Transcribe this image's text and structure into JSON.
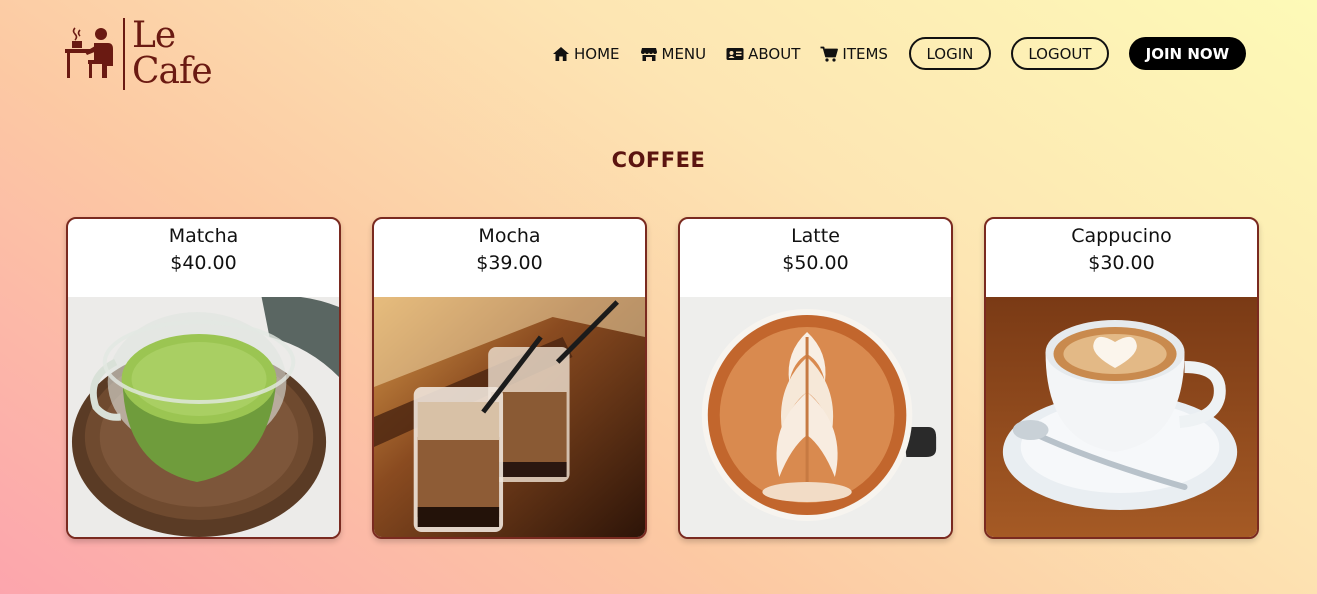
{
  "logo": {
    "line1": "Le",
    "line2": "Cafe"
  },
  "nav": {
    "home": "HOME",
    "menu": "MENU",
    "about": "ABOUT",
    "items": "ITEMS",
    "login": "LOGIN",
    "logout": "LOGOUT",
    "join": "JOIN NOW"
  },
  "section": {
    "title": "COFFEE"
  },
  "products": [
    {
      "name": "Matcha",
      "price": "$40.00",
      "image": "matcha-latte-cup"
    },
    {
      "name": "Mocha",
      "price": "$39.00",
      "image": "iced-mocha-glasses"
    },
    {
      "name": "Latte",
      "price": "$50.00",
      "image": "latte-art-cup"
    },
    {
      "name": "Cappucino",
      "price": "$30.00",
      "image": "cappuccino-cup-saucer"
    }
  ],
  "colors": {
    "brand": "#6a1a12",
    "title": "#5b1410",
    "card_border": "#7a2a20",
    "join_bg": "#000000"
  }
}
